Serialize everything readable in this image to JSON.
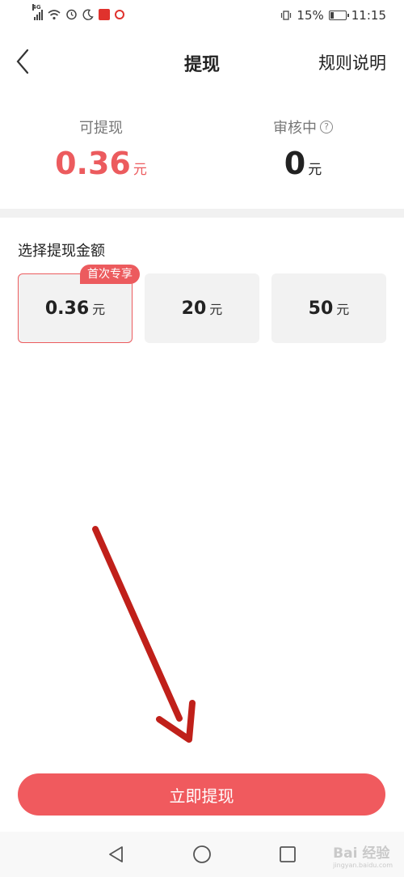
{
  "status_bar": {
    "network_tag": "4G",
    "battery": "15%",
    "time": "11:15"
  },
  "nav": {
    "title": "提现",
    "rules_link": "规则说明"
  },
  "balances": {
    "available_label": "可提现",
    "available_amount": "0.36",
    "available_unit": "元",
    "pending_label": "审核中",
    "pending_amount": "0",
    "pending_unit": "元"
  },
  "amount_section": {
    "label": "选择提现金额",
    "options": [
      {
        "amount": "0.36",
        "unit": "元",
        "badge": "首次专享",
        "selected": true
      },
      {
        "amount": "20",
        "unit": "元",
        "selected": false
      },
      {
        "amount": "50",
        "unit": "元",
        "selected": false
      }
    ]
  },
  "submit_label": "立即提现",
  "watermark": {
    "brand": "Bai 经验",
    "url": "jingyan.baidu.com"
  },
  "colors": {
    "accent": "#ec5b5e",
    "button": "#f05a5e",
    "arrow": "#c0201a"
  }
}
